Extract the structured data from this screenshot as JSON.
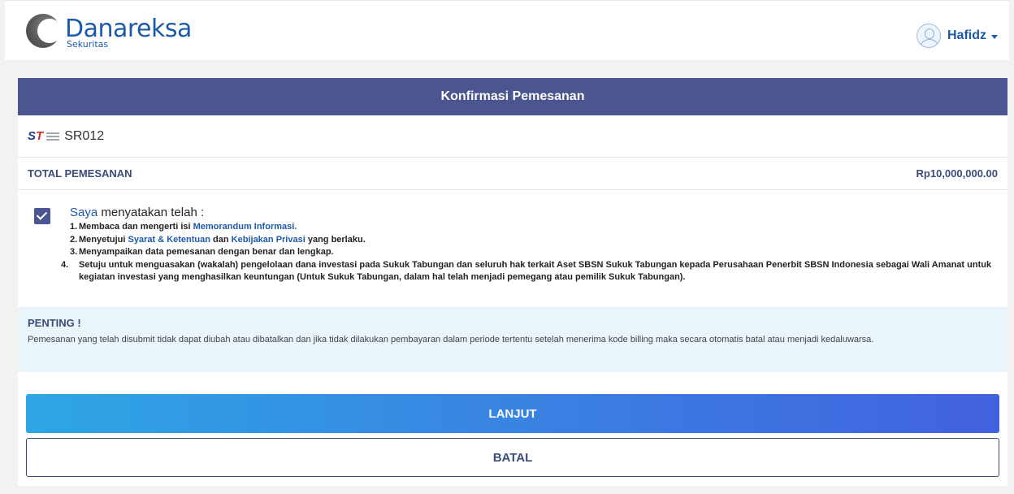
{
  "brand": {
    "name": "Danareksa",
    "sub": "Sekuritas",
    "color": "#1d5aa8"
  },
  "user": {
    "name": "Hafidz",
    "avatar_icon": "user-avatar-icon",
    "menu_icon": "caret-down-icon"
  },
  "page": {
    "title": "Konfirmasi Pemesanan",
    "header_color": "#4b5590"
  },
  "product": {
    "logo_icon": "sukuk-tabungan-logo-icon",
    "code": "SR012"
  },
  "order": {
    "total_label": "TOTAL PEMESANAN",
    "total_value": "Rp10,000,000.00"
  },
  "agreement": {
    "checked": true,
    "heading_highlight": "Saya",
    "heading_rest": " menyatakan telah :",
    "items": [
      {
        "num": "1.",
        "before": "Membaca dan mengerti isi ",
        "link": "Memorandum Informasi.",
        "after": ""
      },
      {
        "num": "2.",
        "before": "Menyetujui ",
        "link1": "Syarat & Ketentuan",
        "middle": " dan ",
        "link2": "Kebijakan Privasi",
        "after": " yang berlaku."
      },
      {
        "num": "3.",
        "text": "Menyampaikan data pemesanan dengan benar dan lengkap."
      },
      {
        "num": "4.",
        "text": "Setuju untuk menguasakan (wakalah) pengelolaan dana investasi pada Sukuk Tabungan dan seluruh hak terkait Aset SBSN Sukuk Tabungan kepada Perusahaan Penerbit SBSN Indonesia sebagai Wali Amanat untuk kegiatan investasi yang menghasilkan keuntungan (Untuk Sukuk Tabungan, dalam hal telah menjadi pemegang atau pemilik Sukuk Tabungan)."
      }
    ]
  },
  "notice": {
    "title": "PENTING !",
    "text": "Pemesanan yang telah disubmit tidak dapat diubah atau dibatalkan dan jika tidak dilakukan pembayaran dalam periode tertentu setelah menerima kode billing maka secara otomatis batal atau menjadi kedaluwarsa."
  },
  "actions": {
    "next_label": "LANJUT",
    "cancel_label": "BATAL"
  }
}
